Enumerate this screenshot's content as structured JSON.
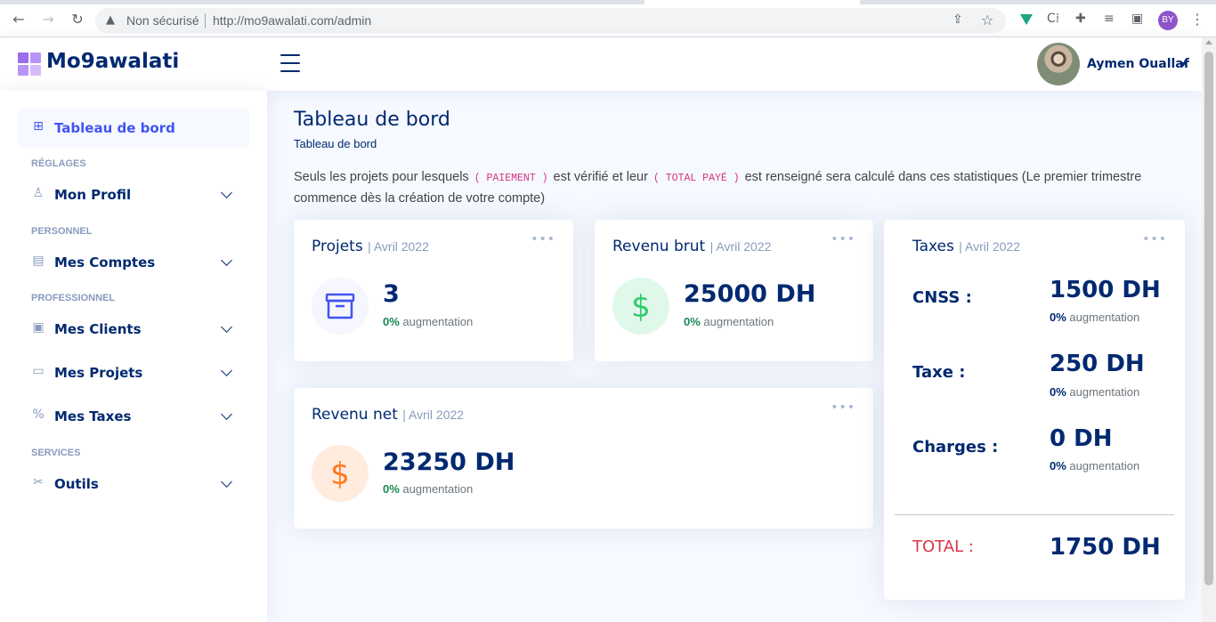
{
  "browser": {
    "security_label": "Non sécurisé",
    "url": "http://mo9awalati.com/admin",
    "profile_initials": "BY"
  },
  "header": {
    "logo_text": "Mo9awalati",
    "user_name": "Aymen Ouallaf"
  },
  "sidebar": {
    "items": [
      {
        "label": "Tableau de bord",
        "icon": "grid-icon"
      },
      {
        "label": "Mon Profil",
        "icon": "person-icon"
      },
      {
        "label": "Mes Comptes",
        "icon": "ledger-icon"
      },
      {
        "label": "Mes Clients",
        "icon": "person-card-icon"
      },
      {
        "label": "Mes Projets",
        "icon": "archive-icon"
      },
      {
        "label": "Mes Taxes",
        "icon": "percent-icon"
      },
      {
        "label": "Outils",
        "icon": "tools-icon"
      }
    ],
    "headings": [
      "RÉGLAGES",
      "PERSONNEL",
      "PROFESSIONNEL",
      "SERVICES"
    ]
  },
  "main": {
    "title": "Tableau de bord",
    "breadcrumb": "Tableau de bord",
    "notice": {
      "part1": "Seuls les projets pour lesquels ",
      "code1": "( PAIEMENT )",
      "part2": " est vérifié et leur ",
      "code2": "( TOTAL PAYÉ )",
      "part3": " est renseigné sera calculé dans ces statistiques (Le premier trimestre commence dès la création de votre compte)"
    }
  },
  "cards": {
    "projets": {
      "title": "Projets",
      "period": "| Avril 2022",
      "value": "3",
      "change": "0%",
      "change_label": "augmentation",
      "icon": "archive-icon",
      "color": "#4154f1"
    },
    "revenu_brut": {
      "title": "Revenu brut",
      "period": "| Avril 2022",
      "value": "25000 DH",
      "change": "0%",
      "change_label": "augmentation",
      "icon": "dollar-icon",
      "color": "#2eca6a"
    },
    "revenu_net": {
      "title": "Revenu net",
      "period": "| Avril 2022",
      "value": "23250 DH",
      "change": "0%",
      "change_label": "augmentation",
      "icon": "dollar-icon",
      "color": "#ff771d"
    },
    "taxes": {
      "title": "Taxes",
      "period": "| Avril 2022",
      "rows": [
        {
          "label": "CNSS :",
          "value": "1500 DH",
          "change": "0%",
          "change_label": "augmentation"
        },
        {
          "label": "Taxe :",
          "value": "250 DH",
          "change": "0%",
          "change_label": "augmentation"
        },
        {
          "label": "Charges :",
          "value": "0 DH",
          "change": "0%",
          "change_label": "augmentation"
        }
      ],
      "total_label": "TOTAL :",
      "total_value": "1750 DH"
    }
  },
  "colors": {
    "primary": "#4154f1",
    "navy": "#012970",
    "muted": "#899bbd",
    "success": "#198754",
    "danger": "#dc3545"
  }
}
